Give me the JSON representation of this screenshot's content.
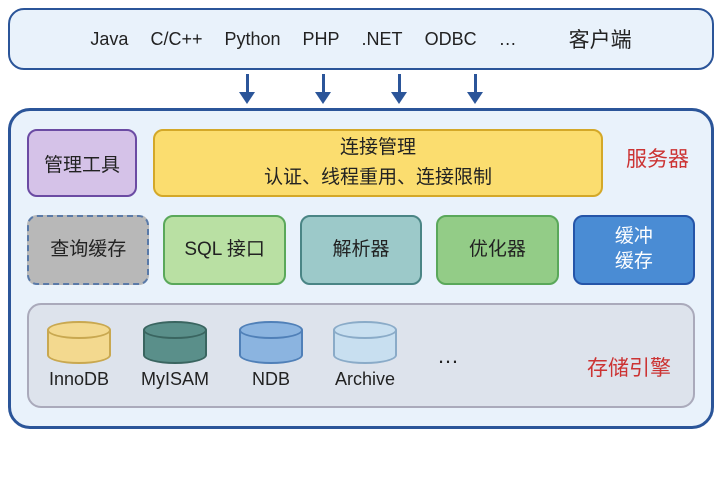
{
  "client": {
    "techs": [
      "Java",
      "C/C++",
      "Python",
      "PHP",
      ".NET",
      "ODBC",
      "…"
    ],
    "label": "客户端"
  },
  "server": {
    "label": "服务器",
    "mgmt_tool": "管理工具",
    "conn_mgmt_line1": "连接管理",
    "conn_mgmt_line2": "认证、线程重用、连接限制",
    "query_cache": "查询缓存",
    "sql_iface": "SQL 接口",
    "parser": "解析器",
    "optimizer": "优化器",
    "buf_cache_line1": "缓冲",
    "buf_cache_line2": "缓存"
  },
  "storage": {
    "label": "存储引擎",
    "engines": [
      "InnoDB",
      "MyISAM",
      "NDB",
      "Archive"
    ],
    "more": "…"
  }
}
